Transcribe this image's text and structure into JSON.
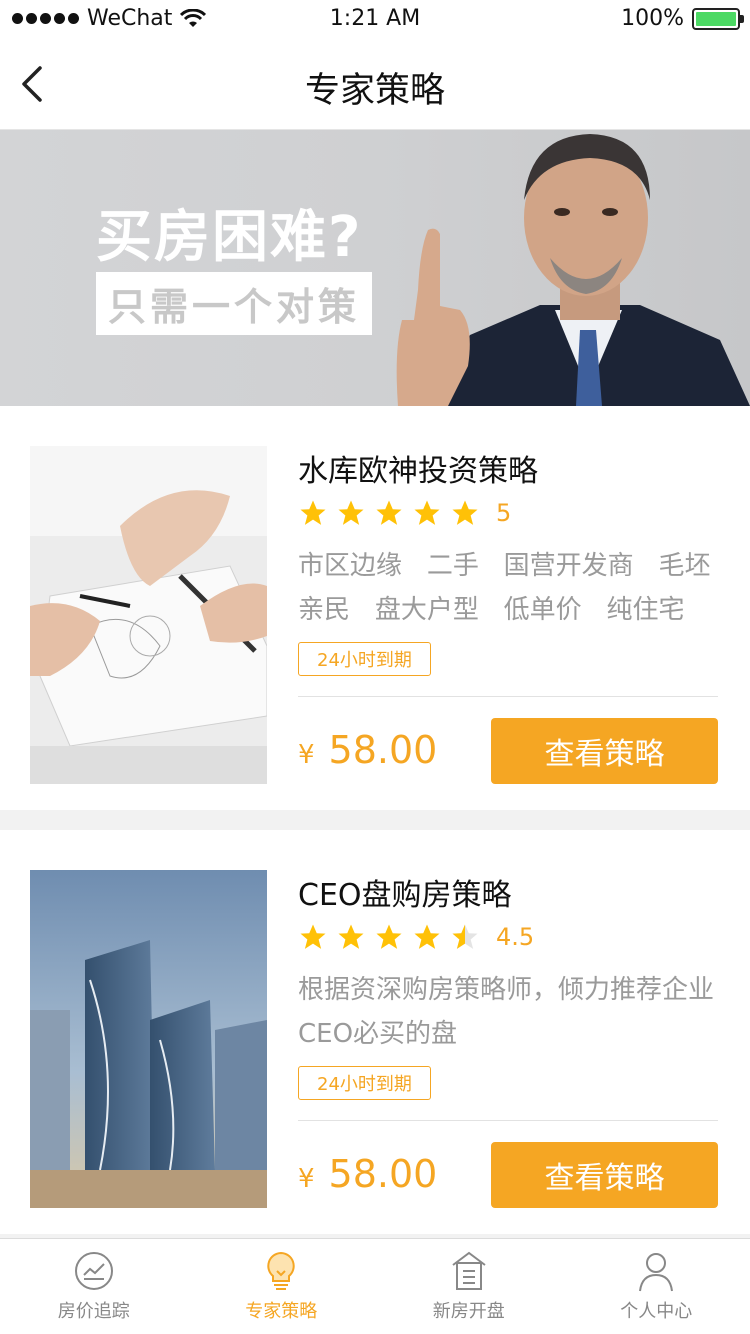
{
  "status_bar": {
    "carrier": "WeChat",
    "time": "1:21 AM",
    "battery": "100%"
  },
  "nav": {
    "title": "专家策略"
  },
  "banner": {
    "headline": "买房困难?",
    "subline": "只需一个对策"
  },
  "strategies": [
    {
      "title": "水库欧神投资策略",
      "stars": 5,
      "rating": "5",
      "tags": [
        "市区边缘",
        "二手",
        "国营开发商",
        "毛坯",
        "亲民",
        "盘大户型",
        "低单价",
        "纯住宅"
      ],
      "expiry": "24小时到期",
      "currency": "¥",
      "price": "58.00",
      "button": "查看策略"
    },
    {
      "title": "CEO盘购房策略",
      "stars": 4.5,
      "rating": "4.5",
      "description": "根据资深购房策略师，倾力推荐企业CEO必买的盘",
      "expiry": "24小时到期",
      "currency": "¥",
      "price": "58.00",
      "button": "查看策略"
    }
  ],
  "tabbar": {
    "items": [
      {
        "label": "房价追踪",
        "icon": "trend-icon"
      },
      {
        "label": "专家策略",
        "icon": "bulb-icon",
        "active": true
      },
      {
        "label": "新房开盘",
        "icon": "building-icon"
      },
      {
        "label": "个人中心",
        "icon": "person-icon"
      }
    ]
  },
  "colors": {
    "accent": "#f5a623",
    "text": "#222222",
    "muted": "#9a9a9a"
  }
}
